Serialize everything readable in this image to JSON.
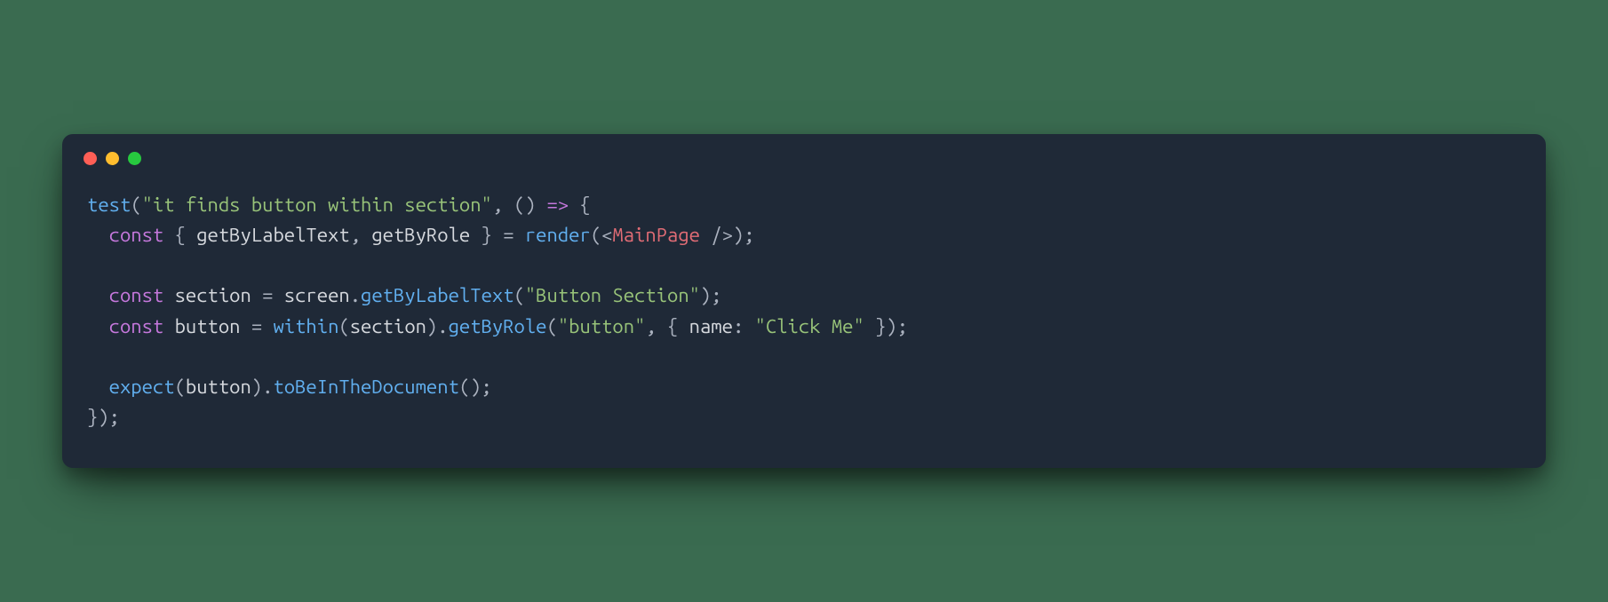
{
  "window": {
    "trafficLights": [
      "red",
      "yellow",
      "green"
    ]
  },
  "code": {
    "tokens": [
      {
        "text": "test",
        "class": "tok-fn"
      },
      {
        "text": "(",
        "class": "tok-punct"
      },
      {
        "text": "\"it finds button within section\"",
        "class": "tok-str"
      },
      {
        "text": ", () ",
        "class": "tok-punct"
      },
      {
        "text": "=>",
        "class": "tok-kw"
      },
      {
        "text": " {",
        "class": "tok-punct"
      },
      {
        "text": "\n  ",
        "class": ""
      },
      {
        "text": "const",
        "class": "tok-kw"
      },
      {
        "text": " { ",
        "class": "tok-punct"
      },
      {
        "text": "getByLabelText",
        "class": "tok-ident"
      },
      {
        "text": ", ",
        "class": "tok-punct"
      },
      {
        "text": "getByRole",
        "class": "tok-ident"
      },
      {
        "text": " } = ",
        "class": "tok-punct"
      },
      {
        "text": "render",
        "class": "tok-fn"
      },
      {
        "text": "(",
        "class": "tok-punct"
      },
      {
        "text": "<",
        "class": "tok-punct"
      },
      {
        "text": "MainPage ",
        "class": "tok-tag"
      },
      {
        "text": "/>",
        "class": "tok-punct"
      },
      {
        "text": ");",
        "class": "tok-punct"
      },
      {
        "text": "\n\n  ",
        "class": ""
      },
      {
        "text": "const",
        "class": "tok-kw"
      },
      {
        "text": " ",
        "class": ""
      },
      {
        "text": "section",
        "class": "tok-ident"
      },
      {
        "text": " = ",
        "class": "tok-punct"
      },
      {
        "text": "screen",
        "class": "tok-obj"
      },
      {
        "text": ".",
        "class": "tok-punct"
      },
      {
        "text": "getByLabelText",
        "class": "tok-method"
      },
      {
        "text": "(",
        "class": "tok-punct"
      },
      {
        "text": "\"Button Section\"",
        "class": "tok-str"
      },
      {
        "text": ");",
        "class": "tok-punct"
      },
      {
        "text": "\n  ",
        "class": ""
      },
      {
        "text": "const",
        "class": "tok-kw"
      },
      {
        "text": " ",
        "class": ""
      },
      {
        "text": "button",
        "class": "tok-ident"
      },
      {
        "text": " = ",
        "class": "tok-punct"
      },
      {
        "text": "within",
        "class": "tok-fn"
      },
      {
        "text": "(",
        "class": "tok-punct"
      },
      {
        "text": "section",
        "class": "tok-ident"
      },
      {
        "text": ").",
        "class": "tok-punct"
      },
      {
        "text": "getByRole",
        "class": "tok-method"
      },
      {
        "text": "(",
        "class": "tok-punct"
      },
      {
        "text": "\"button\"",
        "class": "tok-str"
      },
      {
        "text": ", { ",
        "class": "tok-punct"
      },
      {
        "text": "name",
        "class": "tok-prop"
      },
      {
        "text": ": ",
        "class": "tok-punct"
      },
      {
        "text": "\"Click Me\"",
        "class": "tok-str"
      },
      {
        "text": " });",
        "class": "tok-punct"
      },
      {
        "text": "\n\n  ",
        "class": ""
      },
      {
        "text": "expect",
        "class": "tok-fn"
      },
      {
        "text": "(",
        "class": "tok-punct"
      },
      {
        "text": "button",
        "class": "tok-ident"
      },
      {
        "text": ").",
        "class": "tok-punct"
      },
      {
        "text": "toBeInTheDocument",
        "class": "tok-method"
      },
      {
        "text": "();",
        "class": "tok-punct"
      },
      {
        "text": "\n});",
        "class": "tok-punct"
      }
    ]
  }
}
